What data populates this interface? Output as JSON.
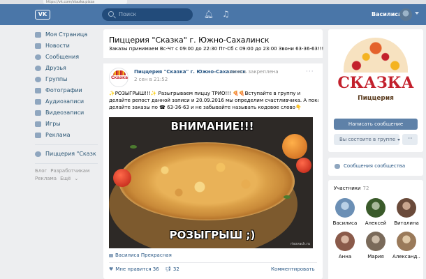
{
  "browser": {
    "url": "https://vk.com/skazka.pizza"
  },
  "header": {
    "logo": "VK",
    "search_placeholder": "Поиск",
    "user_name": "Василиса",
    "icons": [
      "bell-icon",
      "music-icon"
    ]
  },
  "leftnav": {
    "items": [
      {
        "label": "Моя Страница",
        "icon": "home-icon"
      },
      {
        "label": "Новости",
        "icon": "news-icon"
      },
      {
        "label": "Сообщения",
        "icon": "messages-icon"
      },
      {
        "label": "Друзья",
        "icon": "friends-icon"
      },
      {
        "label": "Группы",
        "icon": "groups-icon"
      },
      {
        "label": "Фотографии",
        "icon": "photos-icon"
      },
      {
        "label": "Аудиозаписи",
        "icon": "audio-icon"
      },
      {
        "label": "Видеозаписи",
        "icon": "video-icon"
      },
      {
        "label": "Игры",
        "icon": "games-icon"
      },
      {
        "label": "Реклама",
        "icon": "ads-icon"
      }
    ],
    "bookmark": {
      "label": "Пиццерия \"Сказк",
      "icon": "group-icon"
    },
    "footer": [
      "Блог",
      "Разработчикам",
      "Реклама",
      "Ещё"
    ]
  },
  "main": {
    "group_title": "Пиццерия \"Сказка\" г. Южно-Сахалинск",
    "group_status": "Заказы принимаем Вс-Чт с 09:00 до 22:30 Пт-Сб с 09:00 до 23:00 Звони 63-36-63!!!",
    "post": {
      "avatar_text": "Сказка",
      "author": "Пиццерия \"Сказка\" г. Южно-Сахалинск",
      "pinned": "запись закреплена",
      "date": "2 сен в 21:52",
      "text_lines": [
        "✨РОЗЫГРЫШ!!!✨ Разыгрываем пиццу ТРИО!!! 🍕🍕Вступайте в группу и",
        "делайте репост данной записи и 20.09.2016 мы определим счастливчика. А пока",
        "делайте заказы по ☎ 63-36-63 и не забывайте называть кодовое слово👇"
      ],
      "image_top_text": "ВНИМАНИЕ!!!",
      "image_bottom_text": "РОЗЫГРЫШ ;)",
      "image_watermark": "risovach.ru",
      "photo_credit": "Василиса Прекрасная",
      "likes_label": "Мне нравится",
      "likes_count": "36",
      "shares_count": "32",
      "comments_label": "Комментировать"
    }
  },
  "right": {
    "logo_text": "СКАЗКА",
    "logo_sub": "Пиццерия",
    "message_button": "Написать сообщение",
    "member_button": "Вы состоите в группе",
    "more_button": "···",
    "community_messages": "Сообщения сообщества",
    "members_label": "Участники",
    "members_count": "72",
    "members": [
      {
        "name": "Василиса",
        "color": "#6b8fb5"
      },
      {
        "name": "Алексей",
        "color": "#3a5a2a"
      },
      {
        "name": "Виталина",
        "color": "#6a4a3a"
      },
      {
        "name": "Анна",
        "color": "#8a5a4a"
      },
      {
        "name": "Мария",
        "color": "#7a6a5a"
      },
      {
        "name": "Александ...",
        "color": "#9a7a5a"
      }
    ]
  },
  "colors": {
    "header_blue": "#4a76a8",
    "link_blue": "#2a5885",
    "brand_red": "#c3202c",
    "button_blue": "#5e81a8"
  }
}
